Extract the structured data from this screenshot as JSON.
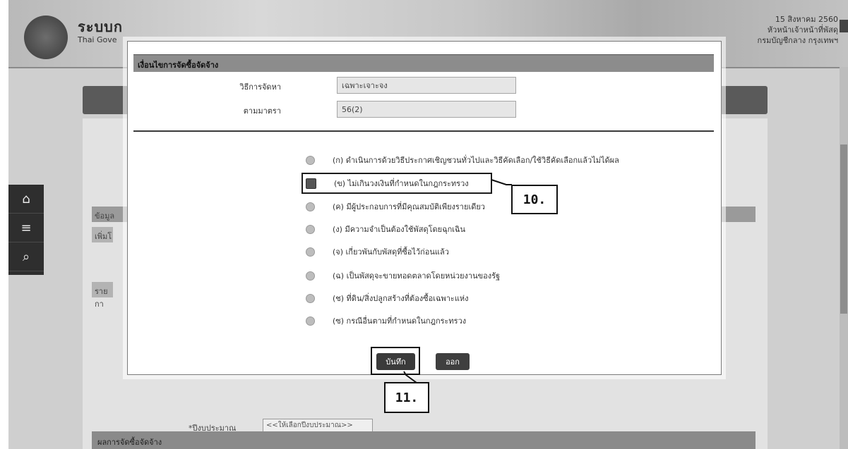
{
  "header": {
    "title": "ระบบก",
    "subtitle": "Thai Gove",
    "date": "15 สิงหาคม 2560",
    "user_line1": "หัวหน้าเจ้าหน้าที่พัสดุ",
    "user_line2": "กรมบัญชีกลาง กรุงเทพฯ"
  },
  "sidebar": {
    "items": [
      {
        "icon": "home-icon",
        "glyph": "⌂"
      },
      {
        "icon": "menu-icon",
        "glyph": "≡"
      },
      {
        "icon": "search-icon",
        "glyph": "⌕"
      }
    ]
  },
  "background": {
    "row1": "ข้อมูล",
    "row2": "เพิ่มโ",
    "row3": "รายกา",
    "budget_label": "*ปีงบประมาณ",
    "budget_select": "<<ให้เลือกปีงบประมาณ>>",
    "bottom_section": "ผลการจัดซื้อจัดจ้าง"
  },
  "modal": {
    "title": "เงื่อนไขการจัดซื้อจัดจ้าง",
    "method_label": "วิธีการจัดหา",
    "method_value": "เฉพาะเจาะจง",
    "section_label": "ตามมาตรา",
    "section_value": "56(2)",
    "options": [
      {
        "text": "(ก) ดำเนินการด้วยวิธีประกาศเชิญชวนทั่วไปและวิธีคัดเลือก/ใช้วิธีคัดเลือกแล้วไม่ได้ผล",
        "checked": false
      },
      {
        "text": "(ข) ไม่เกินวงเงินที่กำหนดในกฎกระทรวง",
        "checked": true
      },
      {
        "text": "(ค) มีผู้ประกอบการที่มีคุณสมบัติเพียงรายเดียว",
        "checked": false
      },
      {
        "text": "(ง) มีความจำเป็นต้องใช้พัสดุโดยฉุกเฉิน",
        "checked": false
      },
      {
        "text": "(จ) เกี่ยวพันกับพัสดุที่ซื้อไว้ก่อนแล้ว",
        "checked": false
      },
      {
        "text": "(ฉ) เป็นพัสดุจะขายทอดตลาดโดยหน่วยงานของรัฐ",
        "checked": false
      },
      {
        "text": "(ช) ที่ดิน/สิ่งปลูกสร้างที่ต้องซื้อเฉพาะแห่ง",
        "checked": false
      },
      {
        "text": "(ซ) กรณีอื่นตามที่กำหนดในกฎกระทรวง",
        "checked": false
      }
    ],
    "save_label": "บันทึก",
    "exit_label": "ออก"
  },
  "callouts": {
    "step10": "10.",
    "step11": "11."
  }
}
